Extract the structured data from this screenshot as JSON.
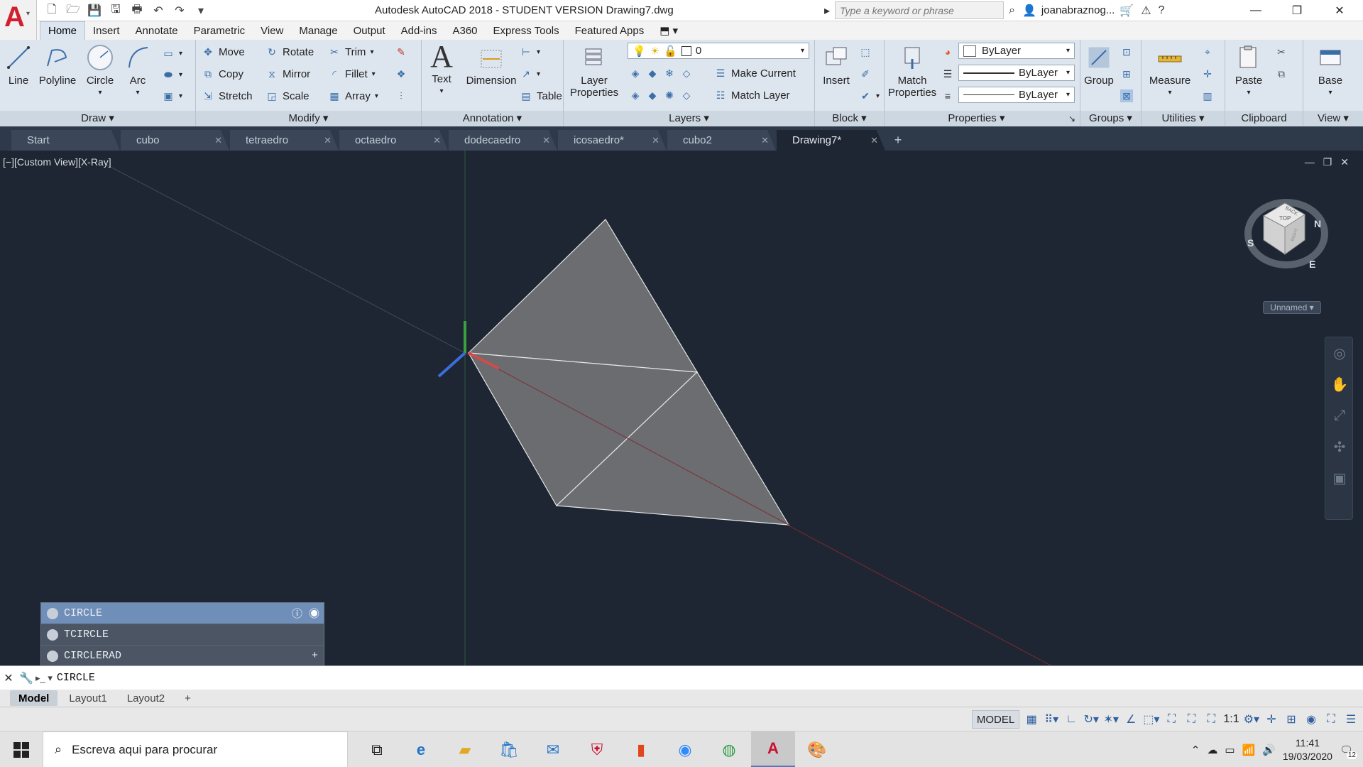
{
  "titlebar": {
    "app_title": "Autodesk AutoCAD 2018 - STUDENT VERSION    Drawing7.dwg",
    "search_placeholder": "Type a keyword or phrase",
    "user": "joanabraznog..."
  },
  "ribbon_tabs": [
    "Home",
    "Insert",
    "Annotate",
    "Parametric",
    "View",
    "Manage",
    "Output",
    "Add-ins",
    "A360",
    "Express Tools",
    "Featured Apps"
  ],
  "ribbon": {
    "draw": {
      "title": "Draw",
      "line": "Line",
      "polyline": "Polyline",
      "circle": "Circle",
      "arc": "Arc"
    },
    "modify": {
      "title": "Modify",
      "move": "Move",
      "rotate": "Rotate",
      "trim": "Trim",
      "copy": "Copy",
      "mirror": "Mirror",
      "fillet": "Fillet",
      "stretch": "Stretch",
      "scale": "Scale",
      "array": "Array"
    },
    "annotation": {
      "title": "Annotation",
      "text": "Text",
      "dimension": "Dimension",
      "table": "Table"
    },
    "layers": {
      "title": "Layers",
      "layer_properties": "Layer Properties",
      "current_layer": "0",
      "make_current": "Make Current",
      "match_layer": "Match Layer"
    },
    "block": {
      "title": "Block",
      "insert": "Insert"
    },
    "properties": {
      "title": "Properties",
      "match_properties": "Match Properties",
      "color": "ByLayer",
      "linetype": "ByLayer",
      "lineweight": "ByLayer"
    },
    "groups": {
      "title": "Groups",
      "group": "Group"
    },
    "utilities": {
      "title": "Utilities",
      "measure": "Measure"
    },
    "clipboard": {
      "title": "Clipboard",
      "paste": "Paste"
    },
    "view": {
      "title": "View",
      "base": "Base"
    }
  },
  "doc_tabs": [
    "Start",
    "cubo",
    "tetraedro",
    "octaedro",
    "dodecaedro",
    "icosaedro*",
    "cubo2",
    "Drawing7*"
  ],
  "viewport": {
    "label": "[−][Custom View][X-Ray]",
    "viewcube": {
      "top": "TOP",
      "back": "BACK",
      "right": "RIGHT",
      "n": "N",
      "s": "S",
      "e": "E"
    },
    "ucs_name": "Unnamed"
  },
  "command_suggestions": [
    "CIRCLE",
    "TCIRCLE",
    "CIRCLERAD"
  ],
  "command_line": {
    "value": "CIRCLE"
  },
  "layout_tabs": [
    "Model",
    "Layout1",
    "Layout2"
  ],
  "statusbar": {
    "model": "MODEL",
    "scale": "1:1"
  },
  "taskbar": {
    "search_placeholder": "Escreva aqui para procurar",
    "time": "11:41",
    "date": "19/03/2020",
    "notifications": "12"
  },
  "colors": {
    "accent": "#2f5f9e",
    "viewport_bg": "#1e2633",
    "logo_red": "#d0202f"
  }
}
